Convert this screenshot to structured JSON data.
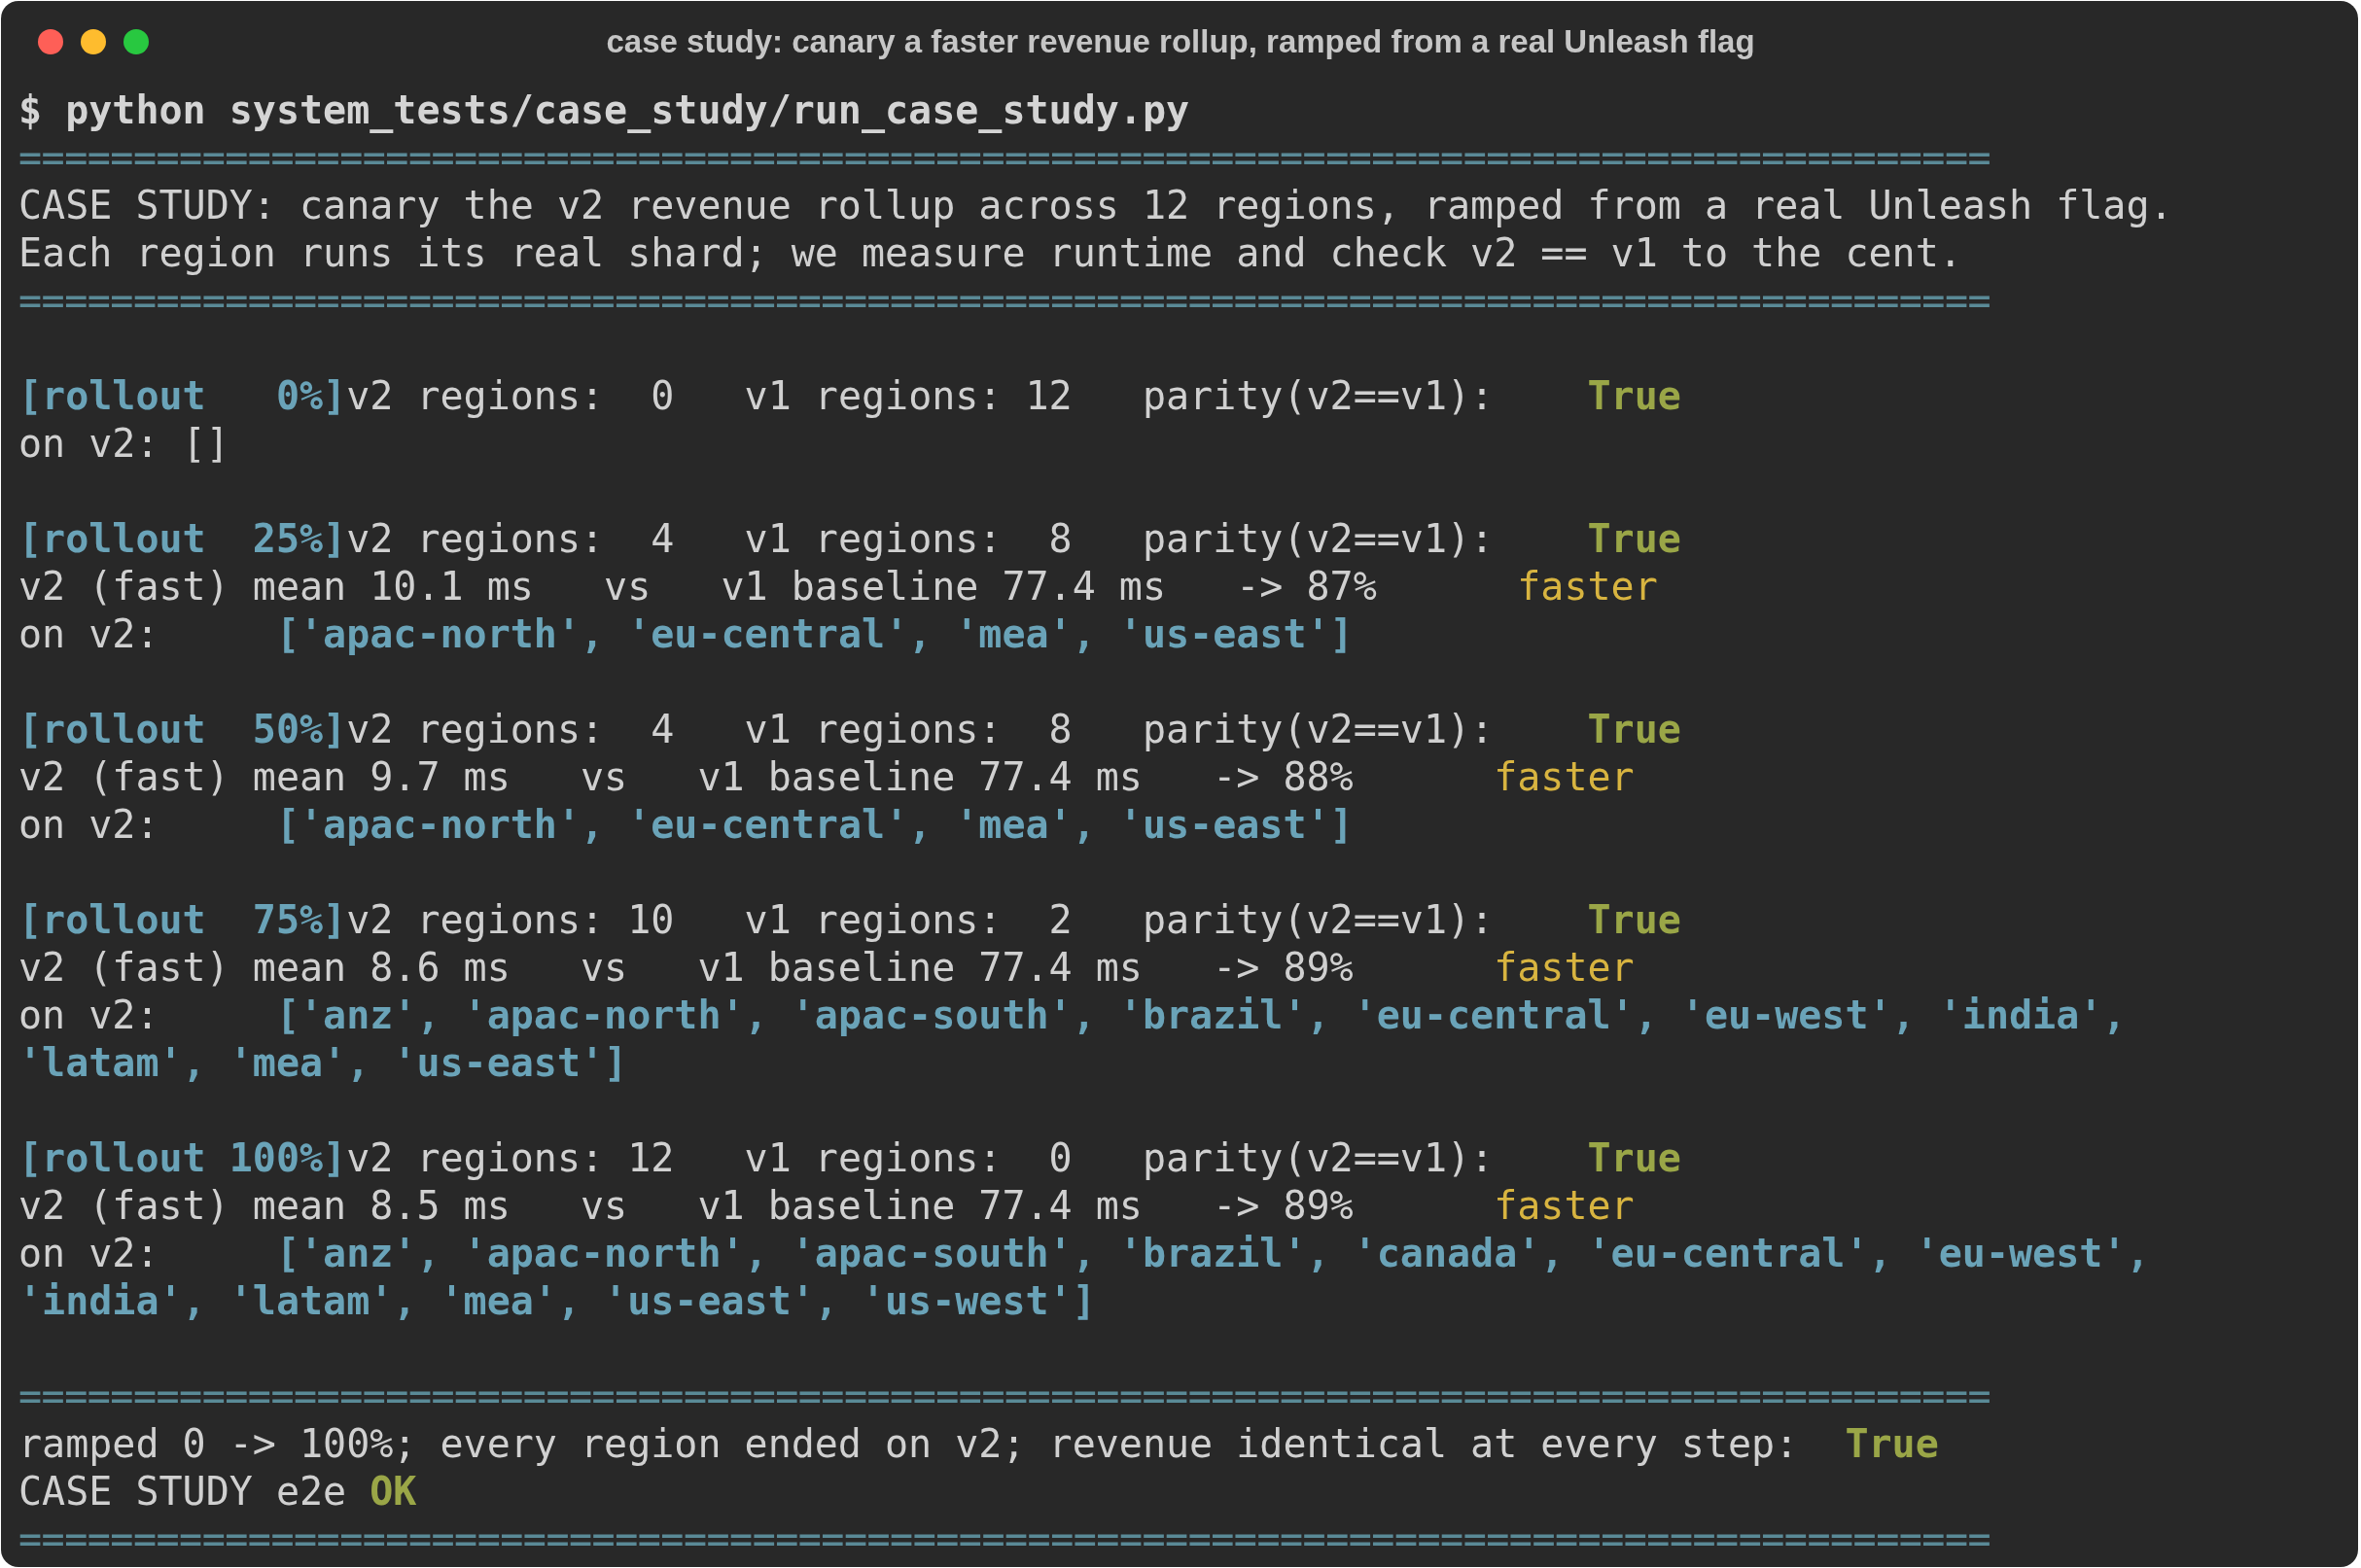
{
  "window": {
    "title": "case study: canary a faster revenue rollup, ramped from a real Unleash flag"
  },
  "terminal": {
    "lines": [
      {
        "kind": "text",
        "segments": [
          {
            "kind": "command",
            "text": "$ python system_tests/case_study/run_case_study.py"
          }
        ]
      },
      {
        "kind": "rule",
        "text": "======================================================================================"
      },
      {
        "kind": "text",
        "segments": [
          {
            "kind": "plain",
            "text": "CASE STUDY: canary the v2 revenue rollup across 12 regions, ramped from a real Unleash flag."
          }
        ]
      },
      {
        "kind": "text",
        "segments": [
          {
            "kind": "plain",
            "text": "Each region runs its real shard; we measure runtime and check v2 == v1 to the cent."
          }
        ]
      },
      {
        "kind": "rule",
        "text": "======================================================================================"
      },
      {
        "kind": "blank"
      },
      {
        "kind": "text",
        "segments": [
          {
            "kind": "label",
            "text": "[rollout   0%]"
          },
          {
            "kind": "plain",
            "text": "v2 regions:  0   v1 regions: 12   parity(v2==v1):    "
          },
          {
            "kind": "true",
            "text": "True"
          }
        ]
      },
      {
        "kind": "text",
        "segments": [
          {
            "kind": "plain",
            "text": "on v2: []"
          }
        ]
      },
      {
        "kind": "blank"
      },
      {
        "kind": "text",
        "segments": [
          {
            "kind": "label",
            "text": "[rollout  25%]"
          },
          {
            "kind": "plain",
            "text": "v2 regions:  4   v1 regions:  8   parity(v2==v1):    "
          },
          {
            "kind": "true",
            "text": "True"
          }
        ]
      },
      {
        "kind": "text",
        "segments": [
          {
            "kind": "plain",
            "text": "v2 (fast) mean 10.1 ms   vs   v1 baseline 77.4 ms   -> 87%      "
          },
          {
            "kind": "speed",
            "text": "faster"
          }
        ]
      },
      {
        "kind": "text",
        "segments": [
          {
            "kind": "plain",
            "text": "on v2:     "
          },
          {
            "kind": "regions",
            "text": "['apac-north', 'eu-central', 'mea', 'us-east']"
          }
        ]
      },
      {
        "kind": "blank"
      },
      {
        "kind": "text",
        "segments": [
          {
            "kind": "label",
            "text": "[rollout  50%]"
          },
          {
            "kind": "plain",
            "text": "v2 regions:  4   v1 regions:  8   parity(v2==v1):    "
          },
          {
            "kind": "true",
            "text": "True"
          }
        ]
      },
      {
        "kind": "text",
        "segments": [
          {
            "kind": "plain",
            "text": "v2 (fast) mean 9.7 ms   vs   v1 baseline 77.4 ms   -> 88%      "
          },
          {
            "kind": "speed",
            "text": "faster"
          }
        ]
      },
      {
        "kind": "text",
        "segments": [
          {
            "kind": "plain",
            "text": "on v2:     "
          },
          {
            "kind": "regions",
            "text": "['apac-north', 'eu-central', 'mea', 'us-east']"
          }
        ]
      },
      {
        "kind": "blank"
      },
      {
        "kind": "text",
        "segments": [
          {
            "kind": "label",
            "text": "[rollout  75%]"
          },
          {
            "kind": "plain",
            "text": "v2 regions: 10   v1 regions:  2   parity(v2==v1):    "
          },
          {
            "kind": "true",
            "text": "True"
          }
        ]
      },
      {
        "kind": "text",
        "segments": [
          {
            "kind": "plain",
            "text": "v2 (fast) mean 8.6 ms   vs   v1 baseline 77.4 ms   -> 89%      "
          },
          {
            "kind": "speed",
            "text": "faster"
          }
        ]
      },
      {
        "kind": "text",
        "segments": [
          {
            "kind": "plain",
            "text": "on v2:     "
          },
          {
            "kind": "regions",
            "text": "['anz', 'apac-north', 'apac-south', 'brazil', 'eu-central', 'eu-west', 'india',"
          }
        ]
      },
      {
        "kind": "text",
        "segments": [
          {
            "kind": "regions",
            "text": "'latam', 'mea', 'us-east']"
          }
        ]
      },
      {
        "kind": "blank"
      },
      {
        "kind": "text",
        "segments": [
          {
            "kind": "label",
            "text": "[rollout 100%]"
          },
          {
            "kind": "plain",
            "text": "v2 regions: 12   v1 regions:  0   parity(v2==v1):    "
          },
          {
            "kind": "true",
            "text": "True"
          }
        ]
      },
      {
        "kind": "text",
        "segments": [
          {
            "kind": "plain",
            "text": "v2 (fast) mean 8.5 ms   vs   v1 baseline 77.4 ms   -> 89%      "
          },
          {
            "kind": "speed",
            "text": "faster"
          }
        ]
      },
      {
        "kind": "text",
        "segments": [
          {
            "kind": "plain",
            "text": "on v2:     "
          },
          {
            "kind": "regions",
            "text": "['anz', 'apac-north', 'apac-south', 'brazil', 'canada', 'eu-central', 'eu-west',"
          }
        ]
      },
      {
        "kind": "text",
        "segments": [
          {
            "kind": "regions",
            "text": "'india', 'latam', 'mea', 'us-east', 'us-west']"
          }
        ]
      },
      {
        "kind": "blank"
      },
      {
        "kind": "rule",
        "text": "======================================================================================"
      },
      {
        "kind": "text",
        "segments": [
          {
            "kind": "plain",
            "text": "ramped 0 -> 100%; every region ended on v2; revenue identical at every step:  "
          },
          {
            "kind": "true",
            "text": "True"
          }
        ]
      },
      {
        "kind": "text",
        "segments": [
          {
            "kind": "plain",
            "text": "CASE STUDY e2e "
          },
          {
            "kind": "true",
            "text": "OK"
          }
        ]
      },
      {
        "kind": "rule",
        "text": "======================================================================================"
      }
    ]
  }
}
